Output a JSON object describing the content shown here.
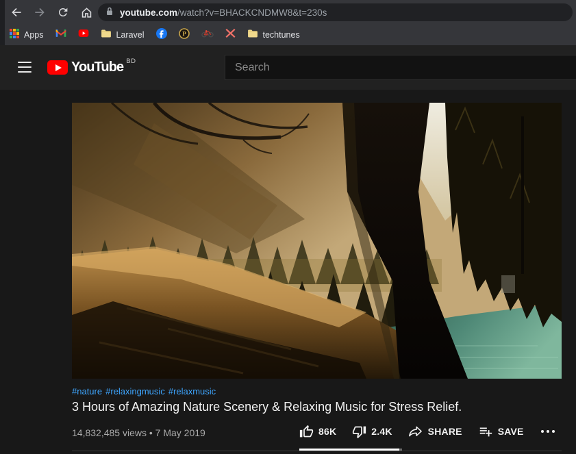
{
  "browser": {
    "url": {
      "host": "youtube.com",
      "path": "/watch?v=BHACKCNDMW8&t=230s"
    },
    "bookmarks": {
      "apps_label": "Apps",
      "laravel_label": "Laravel",
      "techtunes_label": "techtunes"
    }
  },
  "yt": {
    "logo_text": "YouTube",
    "logo_badge": "BD",
    "search_placeholder": "Search",
    "video": {
      "hashtags": [
        "#nature",
        "#relaxingmusic",
        "#relaxmusic"
      ],
      "title": "3 Hours of Amazing Nature Scenery & Relaxing Music for Stress Relief.",
      "stats": "14,832,485 views • 7 May 2019",
      "actions": {
        "like_count": "86K",
        "dislike_count": "2.4K",
        "share_label": "SHARE",
        "save_label": "SAVE"
      },
      "like_bar_percent": 97
    }
  },
  "icons": [
    "back-icon",
    "forward-icon",
    "refresh-icon",
    "home-icon",
    "lock-icon",
    "apps-grid-icon",
    "gmail-icon",
    "youtube-bookmark-icon",
    "folder-icon",
    "facebook-icon",
    "p-badge-icon",
    "bike-icon",
    "x-logo-icon",
    "menu-icon",
    "youtube-logo-icon",
    "thumbs-up-icon",
    "thumbs-down-icon",
    "share-icon",
    "save-icon",
    "more-icon"
  ],
  "colors": {
    "link_blue": "#3ea6ff",
    "youtube_red": "#ff0000",
    "chrome_toolbar": "#35363a",
    "url_pill": "#202124",
    "yt_header_bg": "#212121",
    "page_bg": "#181818",
    "text_secondary": "#aaaaaa"
  }
}
